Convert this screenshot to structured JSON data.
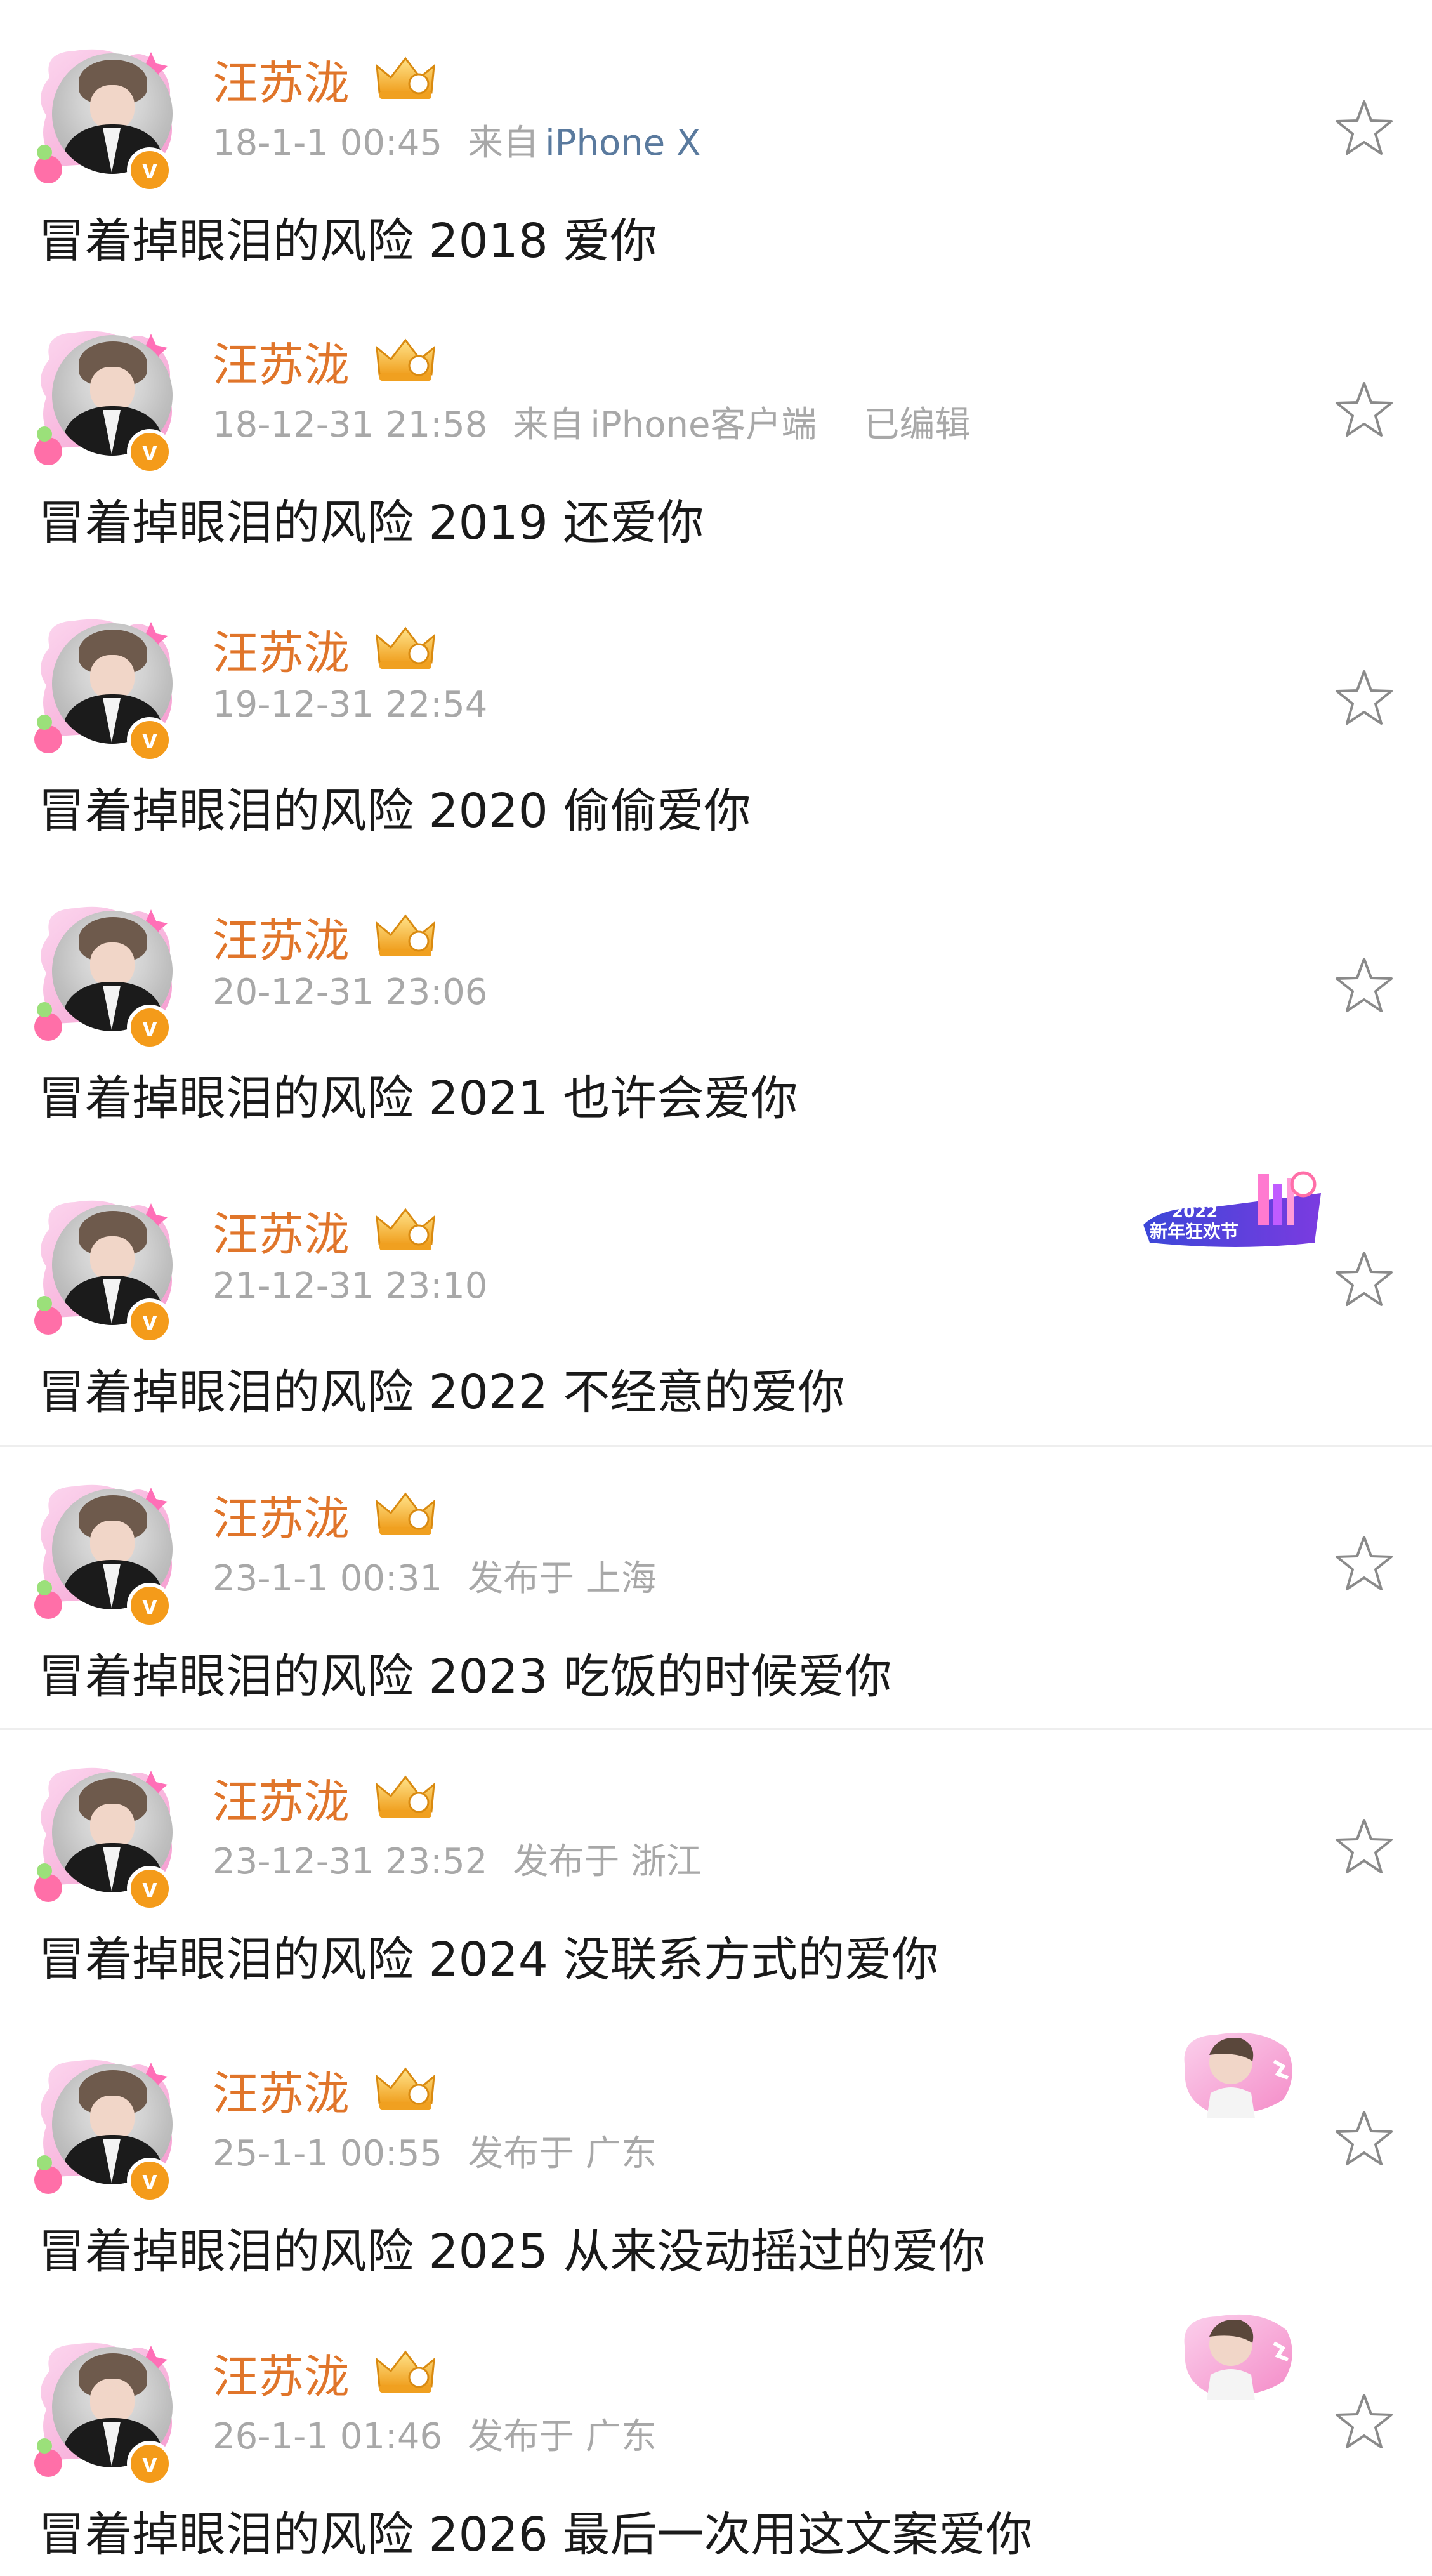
{
  "colors": {
    "name": "#e0752a",
    "meta": "#a8a8a8",
    "source_link": "#5a7a9e",
    "content": "#1a1a1a",
    "verified_badge": "#f49b1a",
    "frame_pink": "#f7a6d6"
  },
  "icons": {
    "star": "star-icon",
    "crown": "crown-icon",
    "verified": "verified-badge-icon"
  },
  "posts": [
    {
      "name": "汪苏泷",
      "time": "18-1-1 00:45",
      "source_label": "来自",
      "source": "iPhone X",
      "content": "冒着掉眼泪的风险 2018 爱你"
    },
    {
      "name": "汪苏泷",
      "time": "18-12-31 21:58",
      "source_label": "来自",
      "source": "iPhone客户端",
      "edited": "已编辑",
      "content": "冒着掉眼泪的风险 2019 还爱你"
    },
    {
      "name": "汪苏泷",
      "time": "19-12-31 22:54",
      "content": "冒着掉眼泪的风险 2020 偷偷爱你"
    },
    {
      "name": "汪苏泷",
      "time": "20-12-31 23:06",
      "content": "冒着掉眼泪的风险 2021 也许会爱你"
    },
    {
      "name": "汪苏泷",
      "time": "21-12-31 23:10",
      "sticker_text": "2022",
      "sticker_text_2": "新年狂欢节",
      "content": "冒着掉眼泪的风险 2022 不经意的爱你"
    },
    {
      "name": "汪苏泷",
      "time": "23-1-1 00:31",
      "location": "发布于 上海",
      "content": "冒着掉眼泪的风险 2023 吃饭的时候爱你"
    },
    {
      "name": "汪苏泷",
      "time": "23-12-31 23:52",
      "location": "发布于 浙江",
      "content": "冒着掉眼泪的风险 2024 没联系方式的爱你"
    },
    {
      "name": "汪苏泷",
      "time": "25-1-1 00:55",
      "location": "发布于 广东",
      "content": "冒着掉眼泪的风险 2025 从来没动摇过的爱你"
    },
    {
      "name": "汪苏泷",
      "time": "26-1-1 01:46",
      "location": "发布于 广东",
      "content": "冒着掉眼泪的风险 2026 最后一次用这文案爱你"
    }
  ]
}
